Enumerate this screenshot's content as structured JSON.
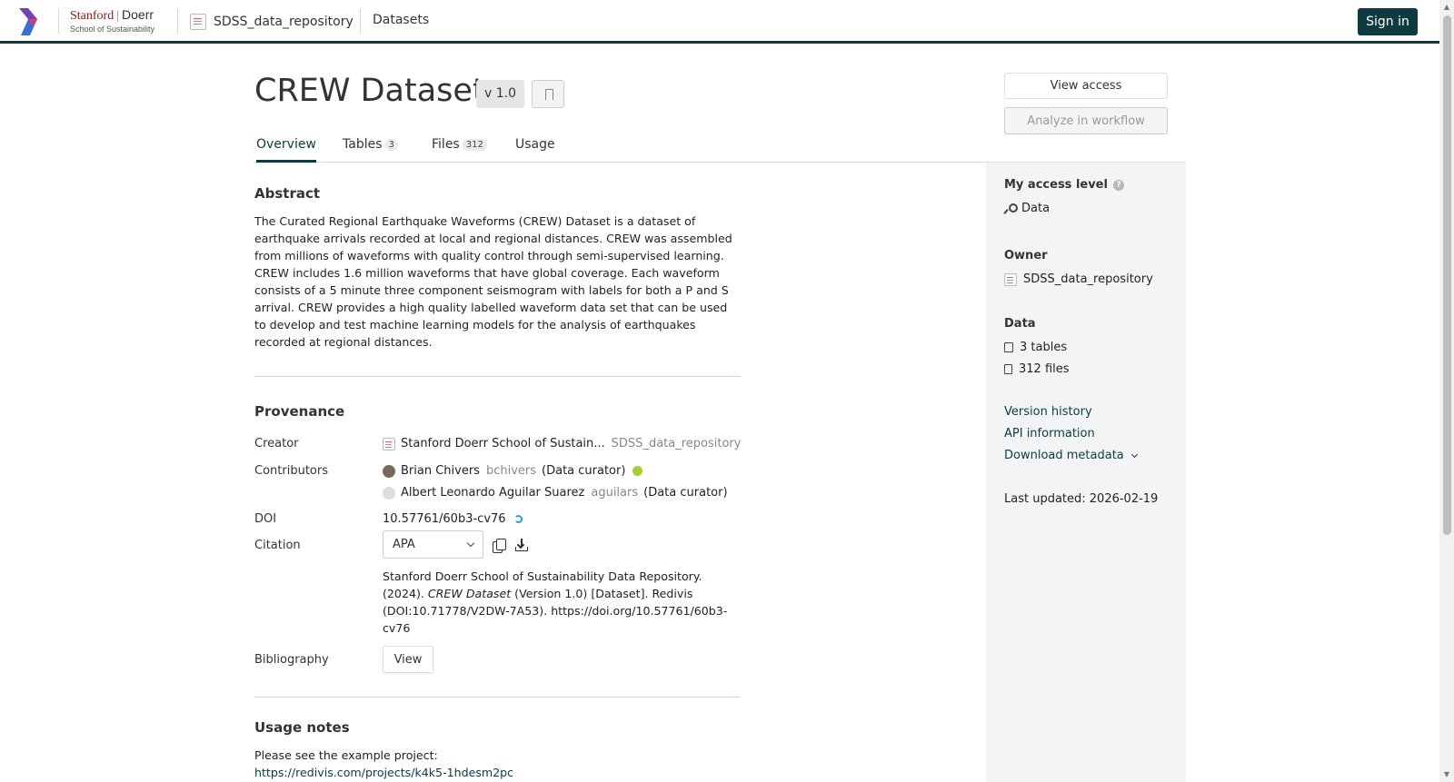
{
  "topbar": {
    "org_name_1": "Stanford",
    "org_name_2": "Doerr",
    "org_sub": "School of Sustainability",
    "repo": "SDSS_data_repository",
    "section": "Datasets",
    "sign_in": "Sign in",
    "accent": "#0d3b3f"
  },
  "header": {
    "title": "CREW Dataset",
    "version": "v 1.0",
    "view_access": "View access",
    "analyze": "Analyze in workflow"
  },
  "tabs": [
    {
      "label": "Overview",
      "count": null,
      "active": true
    },
    {
      "label": "Tables",
      "count": "3"
    },
    {
      "label": "Files",
      "count": "312"
    },
    {
      "label": "Usage",
      "count": null
    }
  ],
  "abstract": {
    "heading": "Abstract",
    "text": "The Curated Regional Earthquake Waveforms (CREW) Dataset is a dataset of earthquake arrivals recorded at local and regional distances. CREW was assembled from millions of waveforms with quality control through semi-supervised learning. CREW includes 1.6 million waveforms that have global coverage. Each waveform consists of a 5 minute three component seismogram with labels for both a P and S arrival. CREW provides a high quality labelled waveform data set that can be used to develop and test machine learning models for the analysis of earthquakes recorded at regional distances."
  },
  "provenance": {
    "heading": "Provenance",
    "creator_label": "Creator",
    "creator_name": "Stanford Doerr School of Sustain...",
    "creator_handle": "SDSS_data_repository",
    "contributors_label": "Contributors",
    "contributors": [
      {
        "name": "Brian Chivers",
        "handle": "bchivers",
        "role": "(Data curator)"
      },
      {
        "name": "Albert Leonardo Aguilar Suarez",
        "handle": "aguilars",
        "role": "(Data curator)"
      }
    ],
    "doi_label": "DOI",
    "doi": "10.57761/60b3-cv76",
    "citation_label": "Citation",
    "citation_format": "APA",
    "citation_part1": "Stanford Doerr School of Sustainability Data Repository. (2024). ",
    "citation_title": "CREW Dataset",
    "citation_part2": " (Version 1.0) [Dataset]. Redivis (DOI:10.71778/V2DW-7A53). https://doi.org/10.57761/60b3-cv76",
    "bibliography_label": "Bibliography",
    "bibliography_button": "View"
  },
  "usage": {
    "heading": "Usage notes",
    "text": "Please see the example project:",
    "link": "https://redivis.com/projects/k4k5-1hdesm2pc"
  },
  "sidebar": {
    "access_label": "My access level",
    "access_help": "?",
    "access_value": "Data",
    "owner_label": "Owner",
    "owner_value": "SDSS_data_repository",
    "data_label": "Data",
    "tables": "3 tables",
    "files": "312 files",
    "version_history": "Version history",
    "api_info": "API information",
    "download_metadata": "Download metadata",
    "last_updated": "Last updated: 2026-02-19"
  }
}
